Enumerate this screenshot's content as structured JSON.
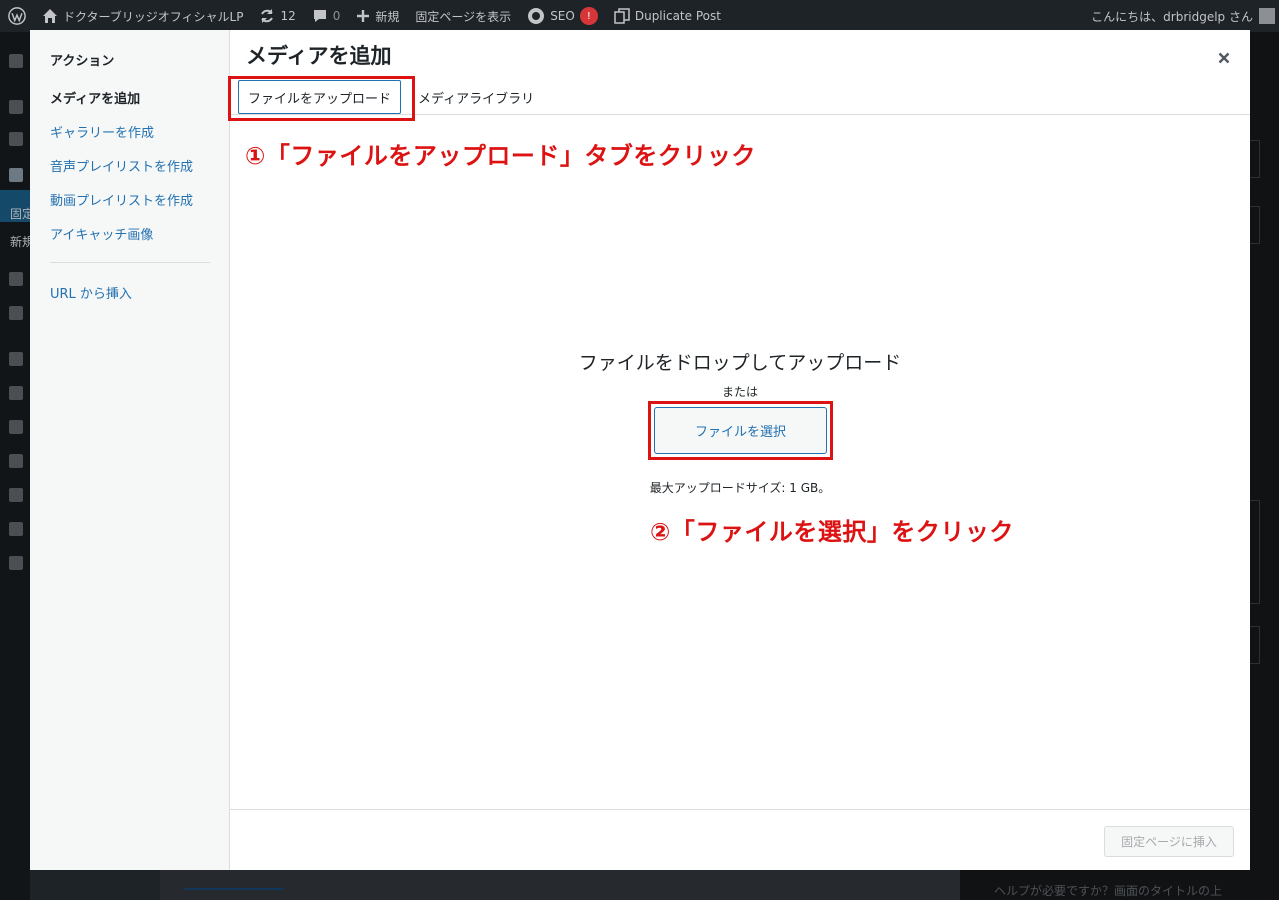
{
  "admin_bar": {
    "site_name": "ドクターブリッジオフィシャルLP",
    "updates_count": "12",
    "comments_count": "0",
    "new_label": "新規",
    "view_page_label": "固定ページを表示",
    "seo_label": "SEO",
    "seo_badge": "!",
    "duplicate_post_label": "Duplicate Post",
    "greeting": "こんにちは、drbridgelp さん"
  },
  "admin_menu": {
    "active_label_1": "固定",
    "active_label_2": "新規"
  },
  "background": {
    "help_text": "ヘルプが必要ですか？画面のタイトルの上"
  },
  "modal": {
    "title": "メディアを追加",
    "close_label": "×",
    "sidebar": {
      "heading": "アクション",
      "items": [
        {
          "label": "メディアを追加"
        },
        {
          "label": "ギャラリーを作成"
        },
        {
          "label": "音声プレイリストを作成"
        },
        {
          "label": "動画プレイリストを作成"
        },
        {
          "label": "アイキャッチ画像"
        },
        {
          "label": "URL から挿入"
        }
      ]
    },
    "tabs": [
      {
        "label": "ファイルをアップロード"
      },
      {
        "label": "メディアライブラリ"
      }
    ],
    "upload": {
      "drop_text": "ファイルをドロップしてアップロード",
      "or_text": "または",
      "select_button": "ファイルを選択",
      "max_size": "最大アップロードサイズ: 1 GB。"
    },
    "insert_button": "固定ページに挿入"
  },
  "annotations": {
    "step1": "①「ファイルをアップロード」タブをクリック",
    "step2": "②「ファイルを選択」をクリック",
    "color": "#dd1313"
  }
}
